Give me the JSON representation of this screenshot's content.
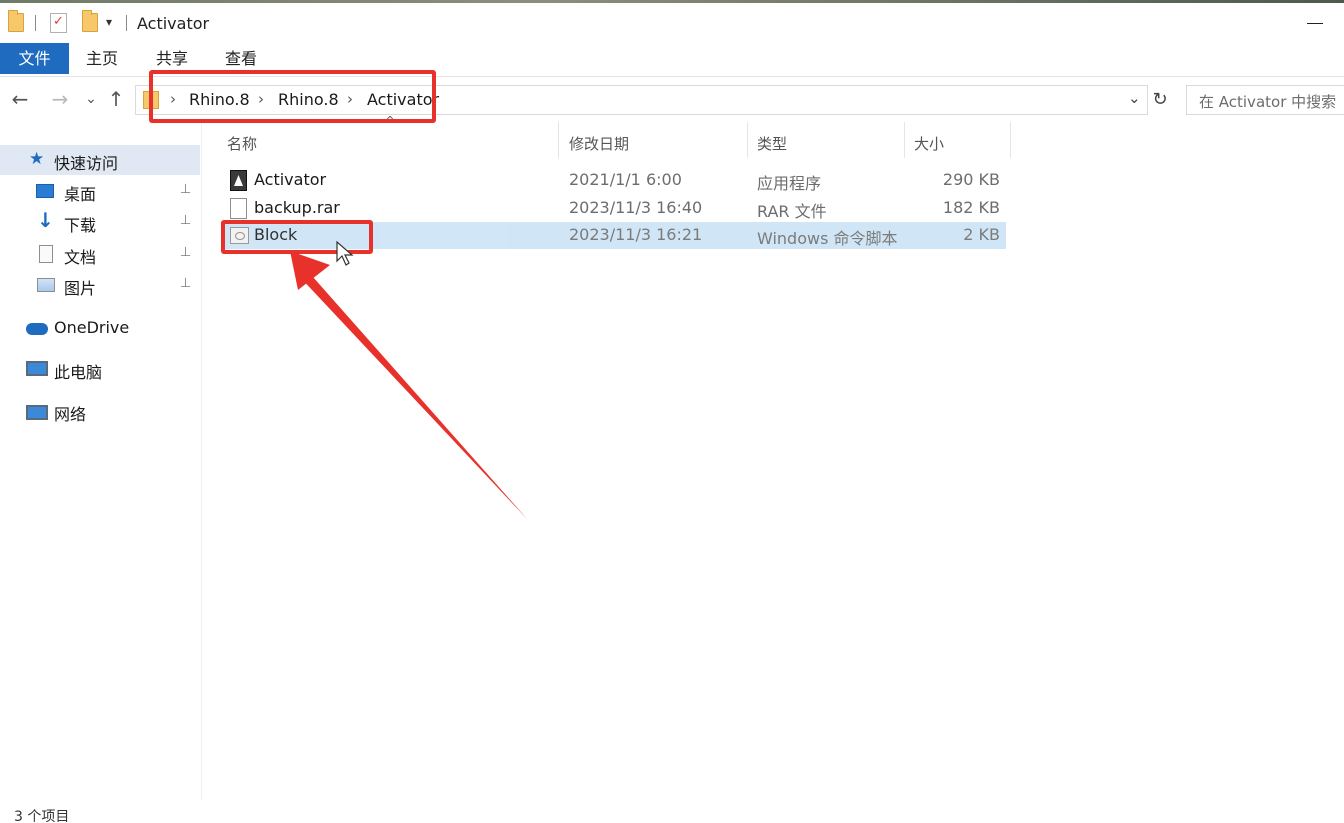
{
  "window": {
    "title": "Activator",
    "quick_access_dropdown": "▾"
  },
  "ribbon": {
    "tabs": [
      {
        "label": "文件"
      },
      {
        "label": "主页"
      },
      {
        "label": "共享"
      },
      {
        "label": "查看"
      }
    ]
  },
  "navigation": {
    "back": "←",
    "forward": "→",
    "recent": "⌄",
    "up": "↑",
    "breadcrumbs": [
      "Rhino.8",
      "Rhino.8",
      "Activator"
    ],
    "separator": "›",
    "address_dropdown": "⌄",
    "refresh": "↻"
  },
  "search": {
    "placeholder": "在 Activator 中搜索"
  },
  "sidebar": {
    "items": [
      {
        "label": "快速访问",
        "icon": "star-icon"
      },
      {
        "label": "桌面",
        "icon": "desktop-icon",
        "pinned": true
      },
      {
        "label": "下载",
        "icon": "download-icon",
        "pinned": true
      },
      {
        "label": "文档",
        "icon": "document-icon",
        "pinned": true
      },
      {
        "label": "图片",
        "icon": "pictures-icon",
        "pinned": true
      },
      {
        "label": "OneDrive",
        "icon": "onedrive-icon"
      },
      {
        "label": "此电脑",
        "icon": "this-pc-icon"
      },
      {
        "label": "网络",
        "icon": "network-icon"
      }
    ],
    "pin_glyph": "📌"
  },
  "file_list": {
    "columns": [
      "名称",
      "修改日期",
      "类型",
      "大小"
    ],
    "sort_indicator": "^",
    "rows": [
      {
        "name": "Activator",
        "modified": "2021/1/1 6:00",
        "type": "应用程序",
        "size": "290 KB",
        "icon": "exe-icon"
      },
      {
        "name": "backup.rar",
        "modified": "2023/11/3 16:40",
        "type": "RAR 文件",
        "size": "182 KB",
        "icon": "rar-file-icon"
      },
      {
        "name": "Block",
        "modified": "2023/11/3 16:21",
        "type": "Windows 命令脚本",
        "size": "2 KB",
        "icon": "batch-file-icon",
        "selected": true
      }
    ]
  },
  "status_bar": {
    "item_count": "3 个项目"
  },
  "colors": {
    "ribbon_file_tab": "#1f6bc0",
    "annotation_red": "#e8312a",
    "selection": "#cce4f7",
    "sidebar_active": "#dfe8f3"
  }
}
